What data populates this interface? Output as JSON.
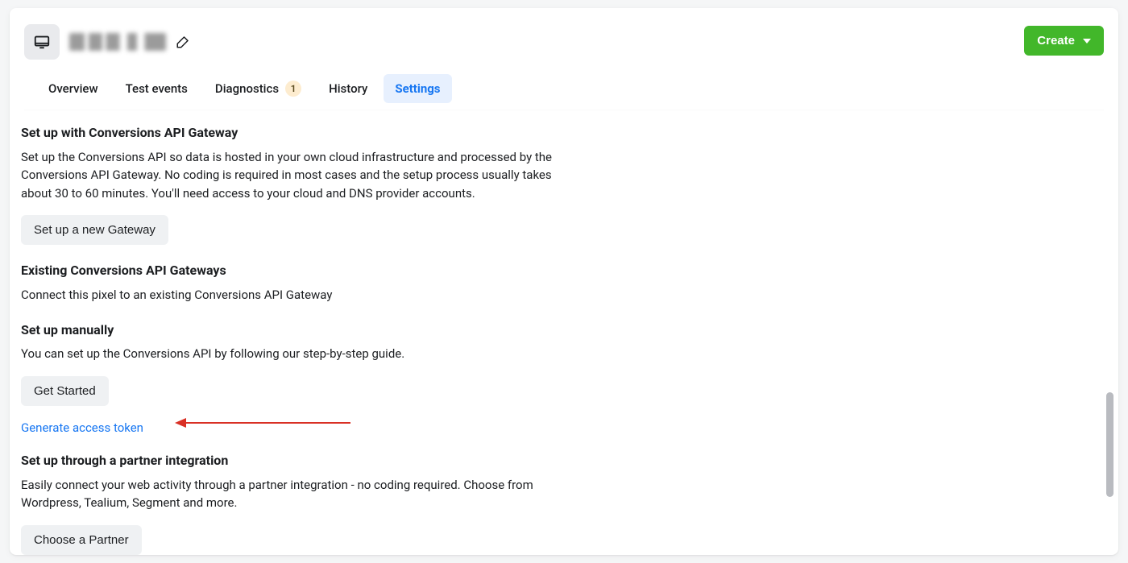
{
  "header": {
    "create_label": "Create"
  },
  "tabs": [
    {
      "label": "Overview",
      "active": false
    },
    {
      "label": "Test events",
      "active": false
    },
    {
      "label": "Diagnostics",
      "active": false,
      "badge": "1"
    },
    {
      "label": "History",
      "active": false
    },
    {
      "label": "Settings",
      "active": true
    }
  ],
  "sections": {
    "gateway": {
      "title": "Set up with Conversions API Gateway",
      "desc": "Set up the Conversions API so data is hosted in your own cloud infrastructure and processed by the Conversions API Gateway. No coding is required in most cases and the setup process usually takes about 30 to 60 minutes. You'll need access to your cloud and DNS provider accounts.",
      "button": "Set up a new Gateway"
    },
    "existing": {
      "title": "Existing Conversions API Gateways",
      "desc": "Connect this pixel to an existing Conversions API Gateway"
    },
    "manual": {
      "title": "Set up manually",
      "desc": "You can set up the Conversions API by following our step-by-step guide.",
      "button": "Get Started",
      "link": "Generate access token"
    },
    "partner": {
      "title": "Set up through a partner integration",
      "desc": "Easily connect your web activity through a partner integration - no coding required. Choose from Wordpress, Tealium, Segment and more.",
      "button": "Choose a Partner"
    }
  }
}
